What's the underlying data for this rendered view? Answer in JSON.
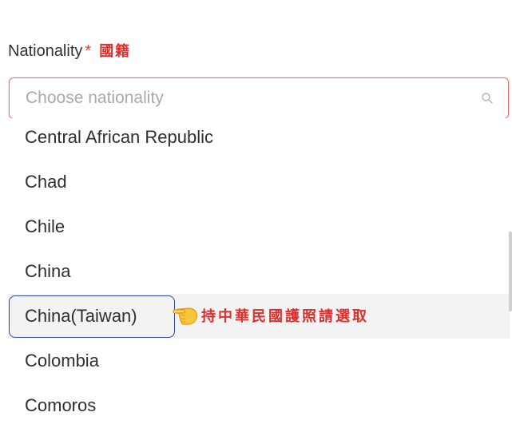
{
  "field": {
    "label": "Nationality",
    "required_marker": "*",
    "label_chinese": "國籍",
    "placeholder": "Choose nationality"
  },
  "icons": {
    "search": "search-icon",
    "pointer": "pointing-hand-icon"
  },
  "dropdown": {
    "options": [
      {
        "label": "Central African Republic"
      },
      {
        "label": "Chad"
      },
      {
        "label": "Chile"
      },
      {
        "label": "China"
      },
      {
        "label": "China(Taiwan)"
      },
      {
        "label": "Colombia"
      },
      {
        "label": "Comoros"
      }
    ],
    "highlighted_option": "China(Taiwan)"
  },
  "annotation": {
    "text": "持中華民國護照請選取"
  },
  "colors": {
    "required": "#e0424b",
    "annotation_red": "#d9312e",
    "input_border_focus": "#ee6e73",
    "highlight_box_border": "#2e4b9a",
    "hover_background": "#f3f3f3"
  }
}
